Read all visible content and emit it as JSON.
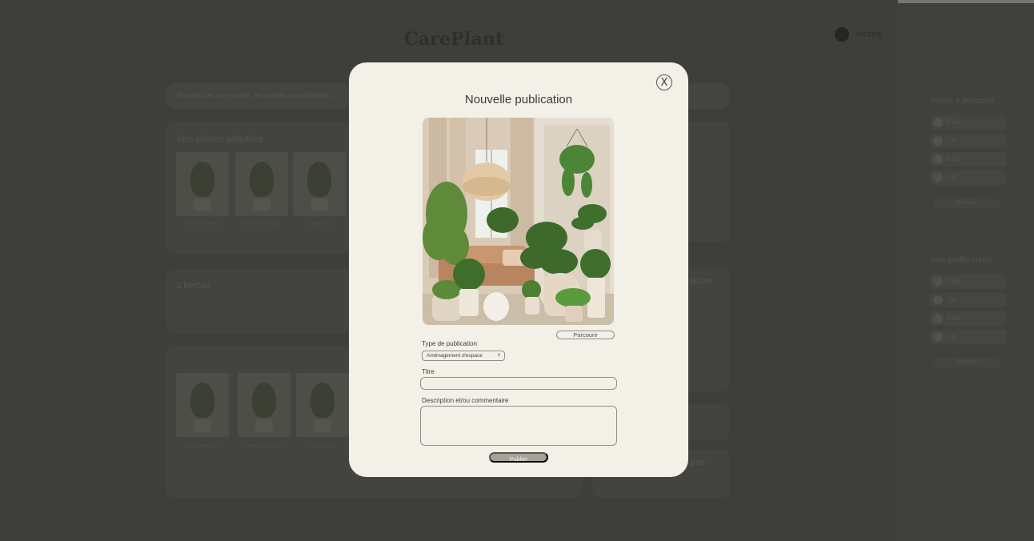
{
  "app": {
    "logo": "CarePlant",
    "user_name": "Ambre"
  },
  "background": {
    "search_placeholder": "Rechercher une plante, un conseil, un utilisateur...",
    "adopted_title": "Mes plantes adoptées",
    "herbarium_title": "L'herbier",
    "adopted_cards": [
      {
        "label": "Plante d'intérieur"
      },
      {
        "label": "Monstera deliciosa"
      },
      {
        "label": "Aglaonema"
      }
    ],
    "lower_cards": [
      {
        "label": "Plante d'intérieur"
      },
      {
        "label": "Monstera deliciosa"
      },
      {
        "label": "Aglaonema"
      }
    ],
    "right_cards": [
      {
        "label": "autour"
      },
      {
        "label": "pins"
      }
    ],
    "sidebar": {
      "discover_title": "Profils à découvrir",
      "discover_items": [
        {
          "name": "Elsa"
        },
        {
          "name": "Lili"
        },
        {
          "name": "Elsa"
        },
        {
          "name": "Lili"
        }
      ],
      "discover_more": "Voir plus",
      "followed_title": "Mes profils suivis",
      "followed_items": [
        {
          "name": "Elsa"
        },
        {
          "name": "Lili"
        },
        {
          "name": "Elsa"
        },
        {
          "name": "Lili"
        }
      ],
      "followed_more": "Voir plus"
    }
  },
  "modal": {
    "close_label": "X",
    "title": "Nouvelle publication",
    "browse_label": "Parcourir",
    "type_label": "Type de publication",
    "type_value": "Aménagement d'espace",
    "type_chevron": "v",
    "title_label": "Titre",
    "title_value": "",
    "description_label": "Description et/ou commentaire",
    "description_value": "",
    "publish_label": "Publier"
  },
  "colors": {
    "overlay": "#3f3f3b",
    "modal_bg": "#f3f0e7",
    "publish_bg": "#a4a496",
    "border": "#8f8f85"
  }
}
